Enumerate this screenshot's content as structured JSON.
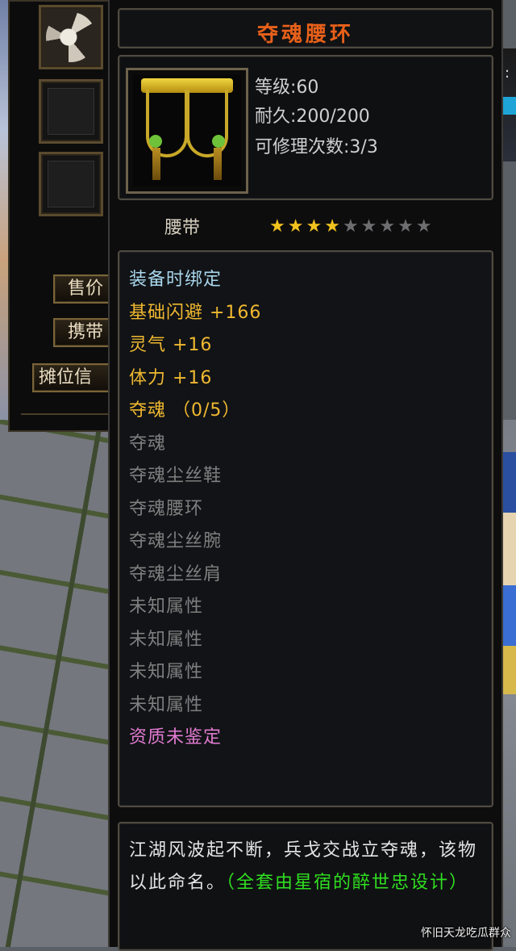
{
  "item": {
    "name": "夺魂腰环",
    "stats": {
      "level": "等级:60",
      "durability": "耐久:200/200",
      "repairs": "可修理次数:3/3"
    },
    "type": "腰带",
    "stars": {
      "filled": 4,
      "total": 9,
      "on_color": "#f2c21e",
      "off_color": "#6e6e70"
    },
    "attributes": [
      {
        "text": "装备时绑定",
        "style": "c-bind"
      },
      {
        "text": "基础闪避 +166",
        "style": "c-gold"
      },
      {
        "text": "灵气 +16",
        "style": "c-gold"
      },
      {
        "text": "体力 +16",
        "style": "c-gold"
      },
      {
        "text": "夺魂 （0/5）",
        "style": "c-gold"
      },
      {
        "text": "夺魂",
        "style": "c-grey"
      },
      {
        "text": "夺魂尘丝鞋",
        "style": "c-grey"
      },
      {
        "text": "夺魂腰环",
        "style": "c-grey"
      },
      {
        "text": "夺魂尘丝腕",
        "style": "c-grey"
      },
      {
        "text": "夺魂尘丝肩",
        "style": "c-grey"
      },
      {
        "text": "未知属性",
        "style": "c-grey"
      },
      {
        "text": "未知属性",
        "style": "c-grey"
      },
      {
        "text": "未知属性",
        "style": "c-grey"
      },
      {
        "text": "未知属性",
        "style": "c-grey"
      },
      {
        "text": "资质未鉴定",
        "style": "c-pink"
      }
    ],
    "description": {
      "main": "江湖风波起不断，兵戈交战立夺魂，该物以此命名。",
      "credit": "（全套由星宿的醉世忠设计）"
    }
  },
  "inventory": {
    "buttons": {
      "sell": "售价",
      "carry": "携带",
      "stall": "摊位信"
    }
  },
  "watermark": "怀旧天龙吃瓜群众",
  "colors": {
    "title": "#e8601a",
    "bind": "#a8d6ec",
    "attribute": "#f0b830",
    "inactive": "#7f7f7f",
    "quality": "#e07ad0",
    "credit": "#2fe020"
  }
}
